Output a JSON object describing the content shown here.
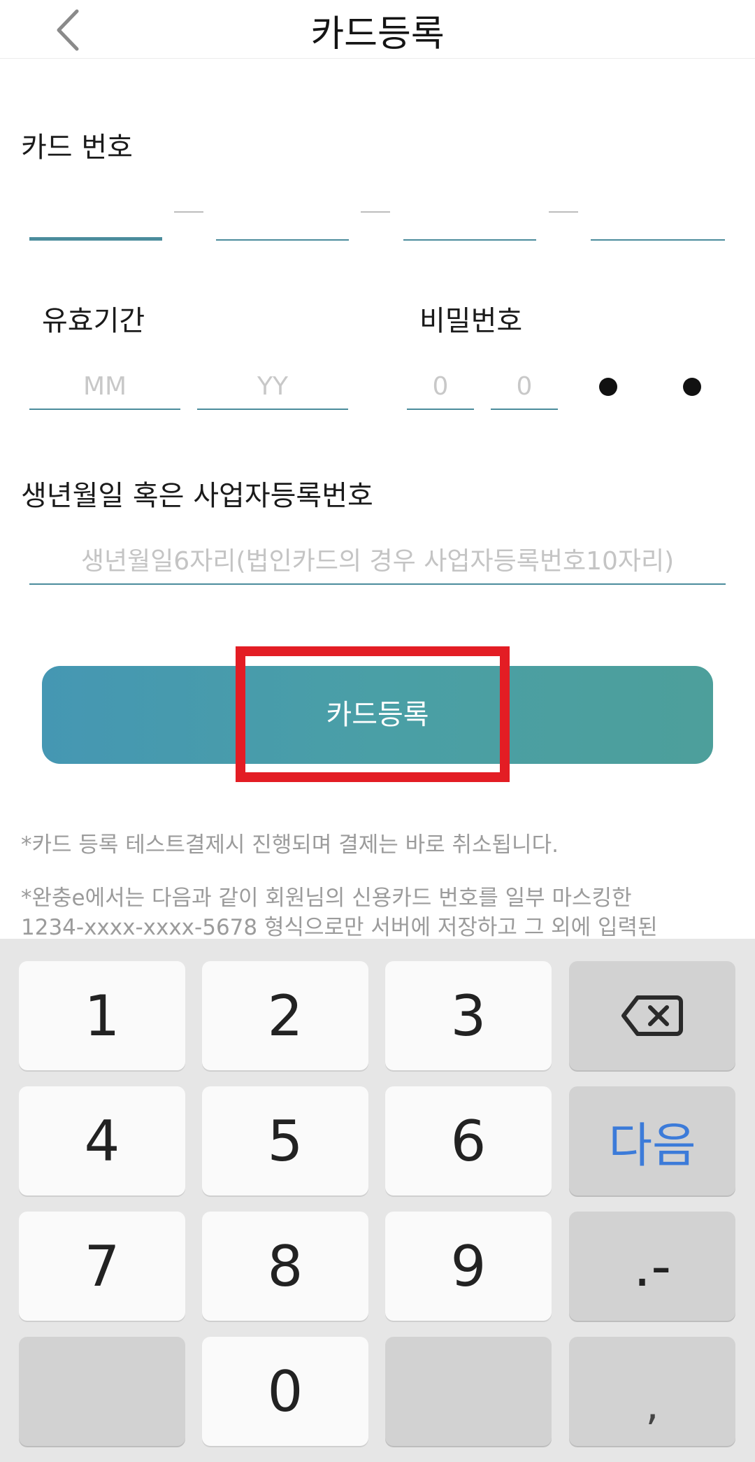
{
  "header": {
    "title": "카드등록"
  },
  "card_number": {
    "label": "카드 번호"
  },
  "expiry": {
    "label": "유효기간",
    "month_placeholder": "MM",
    "year_placeholder": "YY"
  },
  "password": {
    "label": "비밀번호",
    "digit1_placeholder": "0",
    "digit2_placeholder": "0"
  },
  "birth": {
    "label": "생년월일 혹은 사업자등록번호",
    "placeholder": "생년월일6자리(법인카드의 경우 사업자등록번호10자리)"
  },
  "submit": {
    "label": "카드등록"
  },
  "notices": [
    "*카드 등록 테스트결제시 진행되며 결제는 바로 취소됩니다.",
    "*완충e에서는 다음과 같이 회원님의 신용카드 번호를 일부 마스킹한",
    "1234-xxxx-xxxx-5678 형식으로만 서버에 저장하고 그 외에 입력된"
  ],
  "keyboard": {
    "keys": [
      "1",
      "2",
      "3",
      "4",
      "5",
      "6",
      "7",
      "8",
      "9",
      "0"
    ],
    "next_label": "다음",
    "dot_dash_label": ".-",
    "comma_label": ","
  },
  "colors": {
    "accent": "#4b8c9c",
    "button_start": "#4597b3",
    "button_end": "#4d9f9b",
    "highlight": "#e31d24",
    "next_key": "#3c7bd9"
  }
}
